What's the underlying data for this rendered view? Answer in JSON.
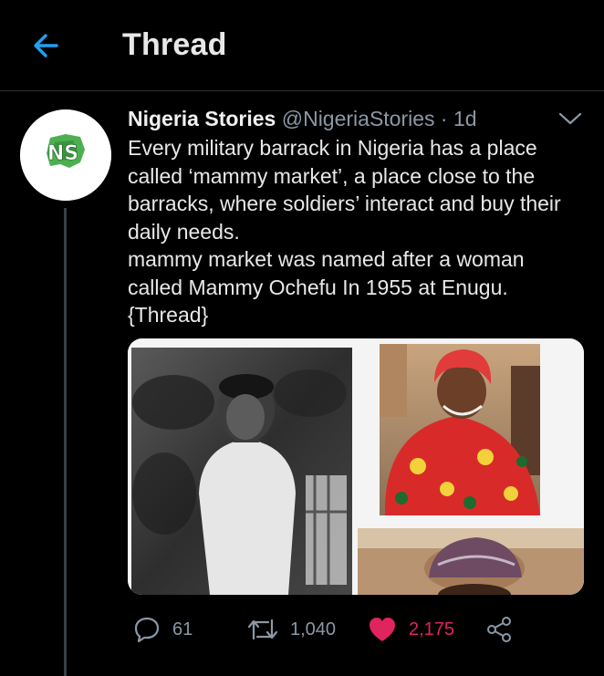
{
  "header": {
    "title": "Thread",
    "back_icon": "arrow-left-icon"
  },
  "tweet": {
    "author": {
      "name": "Nigeria Stories",
      "handle": "@NigeriaStories",
      "time": " · 1d",
      "avatar_initials": "NS",
      "avatar_caption": "Nigeria Stories"
    },
    "text_lines": [
      "Every military barrack in Nigeria has a place called ‘mammy market’, a place close to the barracks, where soldiers’ interact and buy their daily needs.",
      "mammy market was named after a woman called Mammy Ochefu In 1955 at Enugu.",
      "{Thread}"
    ],
    "actions": {
      "replies": "61",
      "retweets": "1,040",
      "likes": "2,175"
    },
    "colors": {
      "accent": "#1da1f2",
      "like": "#e0245e",
      "muted": "#8b98a5"
    }
  }
}
